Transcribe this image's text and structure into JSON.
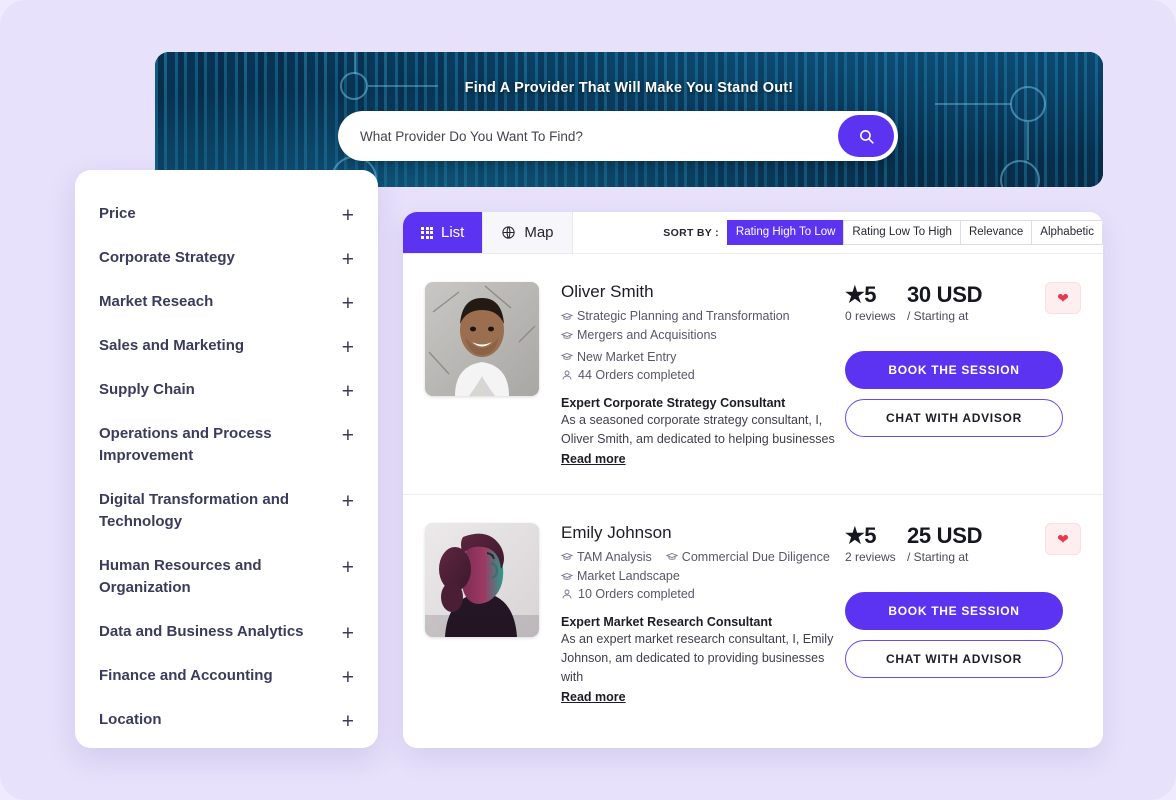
{
  "hero": {
    "title": "Find A Provider That Will Make You Stand Out!",
    "search_placeholder": "What Provider Do You Want To Find?",
    "search_value": "",
    "search_icon": "search-icon"
  },
  "sidebar": {
    "items": [
      {
        "label": "Price",
        "toggle": "+"
      },
      {
        "label": "Corporate Strategy",
        "toggle": "+"
      },
      {
        "label": "Market Reseach",
        "toggle": "+"
      },
      {
        "label": "Sales and Marketing",
        "toggle": "+"
      },
      {
        "label": "Supply Chain",
        "toggle": "+"
      },
      {
        "label": "Operations and Process Improvement",
        "toggle": "+"
      },
      {
        "label": "Digital Transformation and Technology",
        "toggle": "+"
      },
      {
        "label": "Human Resources and Organization",
        "toggle": "+"
      },
      {
        "label": "Data and Business Analytics",
        "toggle": "+"
      },
      {
        "label": "Finance and Accounting",
        "toggle": "+"
      },
      {
        "label": "Location",
        "toggle": "+"
      }
    ]
  },
  "toolbar": {
    "tabs": [
      {
        "label": "List",
        "icon": "grid-icon",
        "active": true
      },
      {
        "label": "Map",
        "icon": "globe-icon",
        "active": false
      }
    ],
    "sort_label": "SORT BY :",
    "sort_options": [
      {
        "label": "Rating High To Low",
        "active": true
      },
      {
        "label": "Rating Low To High",
        "active": false
      },
      {
        "label": "Relevance",
        "active": false
      },
      {
        "label": "Alphabetic",
        "active": false
      }
    ]
  },
  "providers": [
    {
      "name": "Oliver Smith",
      "tags": [
        "Strategic Planning and Transformation",
        "Mergers and Acquisitions",
        "New Market Entry"
      ],
      "orders": "44 Orders completed",
      "headline": "Expert Corporate Strategy Consultant",
      "description": "As a seasoned corporate strategy consultant, I, Oliver Smith, am dedicated to helping businesses",
      "read_more": "Read more",
      "rating": "★5",
      "reviews": "0 reviews",
      "price": "30 USD",
      "price_note": "/ Starting at",
      "favorite_icon": "heart-icon",
      "book_label": "BOOK THE SESSION",
      "chat_label": "CHAT WITH ADVISOR"
    },
    {
      "name": "Emily Johnson",
      "tags": [
        "TAM Analysis",
        "Commercial Due Diligence",
        "Market Landscape"
      ],
      "orders": "10 Orders completed",
      "headline": "Expert Market Research Consultant",
      "description": "As an expert market research consultant, I, Emily Johnson, am dedicated to providing businesses with",
      "read_more": "Read more",
      "rating": "★5",
      "reviews": "2 reviews",
      "price": "25 USD",
      "price_note": "/ Starting at",
      "favorite_icon": "heart-icon",
      "book_label": "BOOK THE SESSION",
      "chat_label": "CHAT WITH ADVISOR"
    }
  ],
  "colors": {
    "accent": "#5b33f0",
    "page_background": "#e7e1fb",
    "favorite": "#e8384f",
    "sidebar_text": "#3b3b5c"
  }
}
